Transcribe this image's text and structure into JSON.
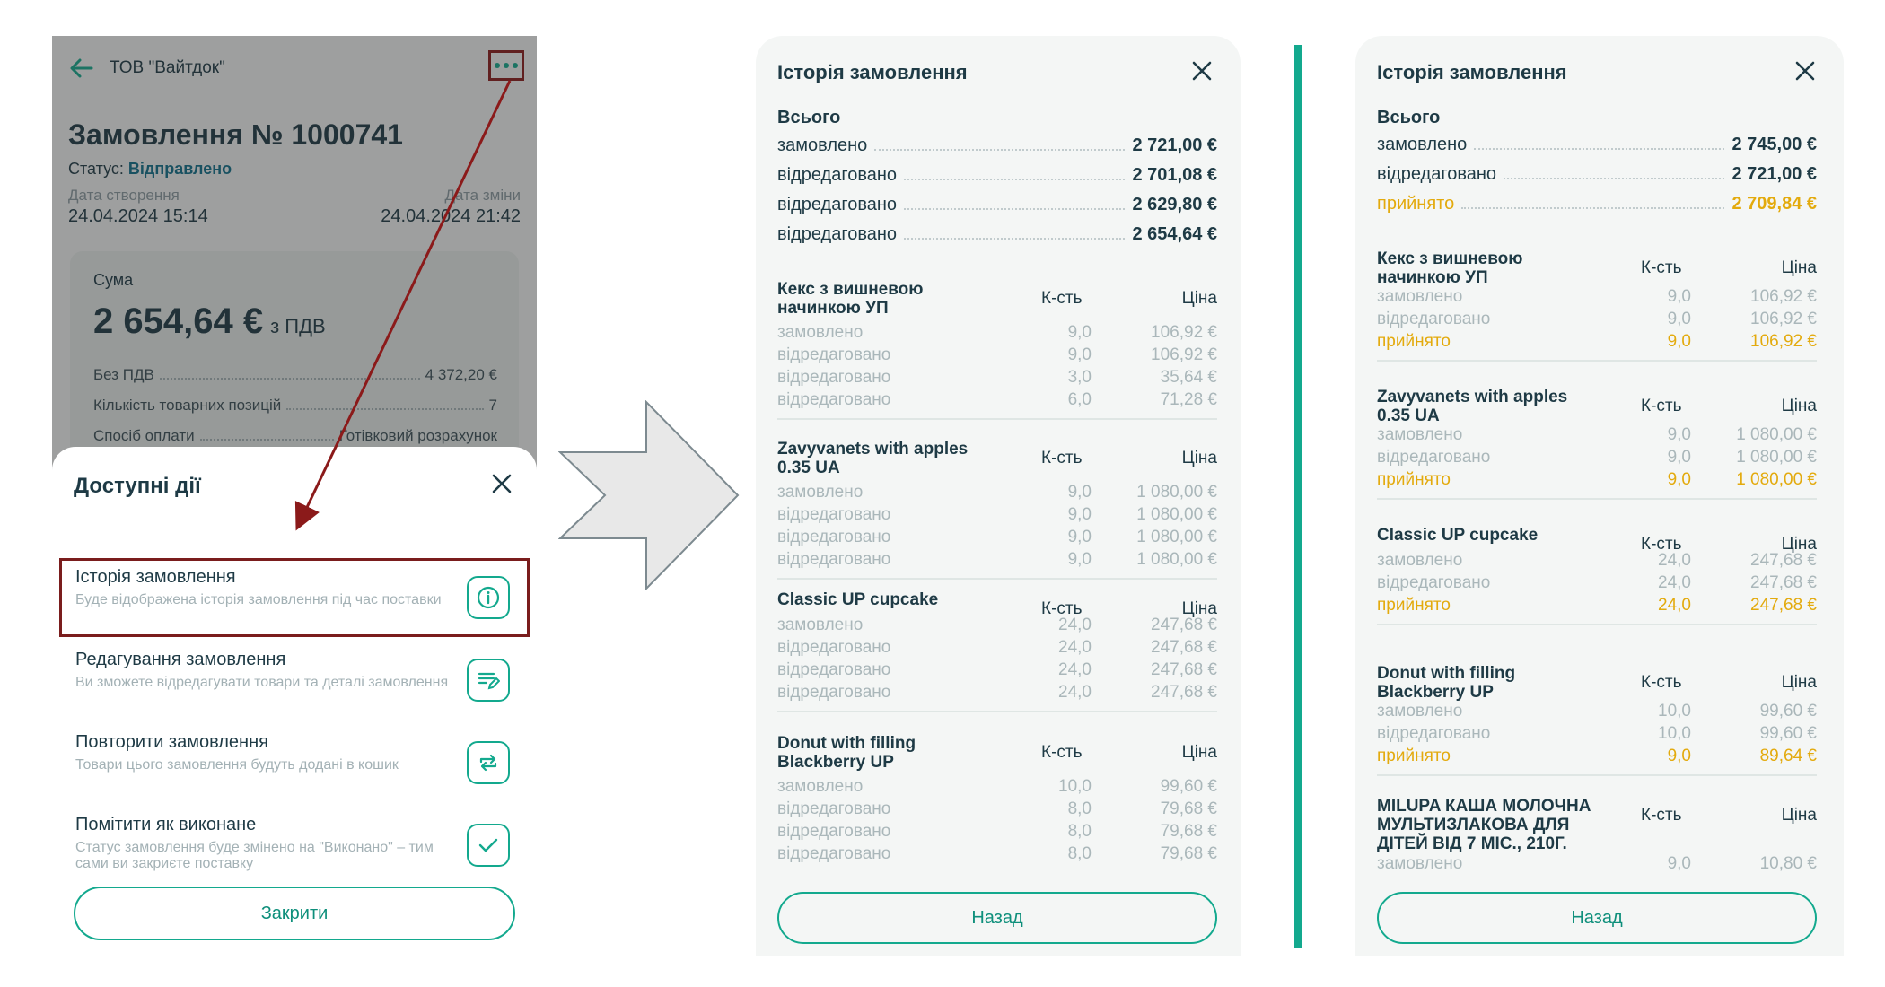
{
  "left": {
    "company": "ТОВ \"Вайтдок\"",
    "order_title": "Замовлення № 1000741",
    "status_label": "Статус:",
    "status_value": "Відправлено",
    "created_label": "Дата створення",
    "created_value": "24.04.2024 15:14",
    "changed_label": "Дата зміни",
    "changed_value": "24.04.2024 21:42",
    "sum_label": "Сума",
    "sum_value": "2 654,64 €",
    "sum_suffix": "з ПДВ",
    "no_vat_label": "Без ПДВ",
    "no_vat_value": "4 372,20 €",
    "positions_label": "Кількість товарних позицій",
    "positions_value": "7",
    "payment_label": "Спосіб оплати",
    "payment_value": "Готівковий розрахунок",
    "sheet_title": "Доступні дії",
    "actions": [
      {
        "title": "Історія замовлення",
        "desc": "Буде відображена історія замовлення під час поставки",
        "icon": "info-icon"
      },
      {
        "title": "Редагування замовлення",
        "desc": "Ви зможете відредагувати товари та деталі замовлення",
        "icon": "edit-list-icon"
      },
      {
        "title": "Повторити замовлення",
        "desc": "Товари цього замовлення будуть додані в кошик",
        "icon": "repeat-icon"
      },
      {
        "title": "Помітити як виконане",
        "desc": "Статус замовлення буде змінено на \"Виконано\" – тим сами ви закриєте поставку",
        "icon": "check-icon"
      }
    ],
    "close_label": "Закрити"
  },
  "mid": {
    "title": "Історія замовлення",
    "total_label": "Всього",
    "totals": [
      {
        "label": "замовлено",
        "value": "2 721,00 €"
      },
      {
        "label": "відредаговано",
        "value": "2 701,08 €"
      },
      {
        "label": "відредаговано",
        "value": "2 629,80 €"
      },
      {
        "label": "відредаговано",
        "value": "2 654,64 €"
      }
    ],
    "qty_header": "К-сть",
    "price_header": "Ціна",
    "items": [
      {
        "name": "Кекс з вишневою начинкою УП",
        "rows": [
          [
            "замовлено",
            "9,0",
            "106,92 €"
          ],
          [
            "відредаговано",
            "9,0",
            "106,92 €"
          ],
          [
            "відредаговано",
            "3,0",
            "35,64 €"
          ],
          [
            "відредаговано",
            "6,0",
            "71,28 €"
          ]
        ]
      },
      {
        "name": "Zavyvanets with apples 0.35 UA",
        "rows": [
          [
            "замовлено",
            "9,0",
            "1 080,00 €"
          ],
          [
            "відредаговано",
            "9,0",
            "1 080,00 €"
          ],
          [
            "відредаговано",
            "9,0",
            "1 080,00 €"
          ],
          [
            "відредаговано",
            "9,0",
            "1 080,00 €"
          ]
        ]
      },
      {
        "name": "Classic UP cupcake",
        "rows": [
          [
            "замовлено",
            "24,0",
            "247,68 €"
          ],
          [
            "відредаговано",
            "24,0",
            "247,68 €"
          ],
          [
            "відредаговано",
            "24,0",
            "247,68 €"
          ],
          [
            "відредаговано",
            "24,0",
            "247,68 €"
          ]
        ]
      },
      {
        "name": "Donut with filling Blackberry UP",
        "rows": [
          [
            "замовлено",
            "10,0",
            "99,60 €"
          ],
          [
            "відредаговано",
            "8,0",
            "79,68 €"
          ],
          [
            "відредаговано",
            "8,0",
            "79,68 €"
          ],
          [
            "відредаговано",
            "8,0",
            "79,68 €"
          ]
        ]
      }
    ],
    "back_label": "Назад"
  },
  "right": {
    "title": "Історія замовлення",
    "total_label": "Всього",
    "totals": [
      {
        "label": "замовлено",
        "value": "2 745,00 €"
      },
      {
        "label": "відредаговано",
        "value": "2 721,00 €"
      },
      {
        "label": "прийнято",
        "value": "2 709,84 €"
      }
    ],
    "qty_header": "К-сть",
    "price_header": "Ціна",
    "items": [
      {
        "name": "Кекс з вишневою начинкою УП",
        "rows": [
          [
            "замовлено",
            "9,0",
            "106,92 €"
          ],
          [
            "відредаговано",
            "9,0",
            "106,92 €"
          ],
          [
            "прийнято",
            "9,0",
            "106,92 €"
          ]
        ]
      },
      {
        "name": "Zavyvanets with apples 0.35 UA",
        "rows": [
          [
            "замовлено",
            "9,0",
            "1 080,00 €"
          ],
          [
            "відредаговано",
            "9,0",
            "1 080,00 €"
          ],
          [
            "прийнято",
            "9,0",
            "1 080,00 €"
          ]
        ]
      },
      {
        "name": "Classic UP cupcake",
        "rows": [
          [
            "замовлено",
            "24,0",
            "247,68 €"
          ],
          [
            "відредаговано",
            "24,0",
            "247,68 €"
          ],
          [
            "прийнято",
            "24,0",
            "247,68 €"
          ]
        ]
      },
      {
        "name": "Donut with filling Blackberry UP",
        "rows": [
          [
            "замовлено",
            "10,0",
            "99,60 €"
          ],
          [
            "відредаговано",
            "10,0",
            "99,60 €"
          ],
          [
            "прийнято",
            "9,0",
            "89,64 €"
          ]
        ]
      },
      {
        "name": "MILUPA КАША МОЛОЧНА МУЛЬТИЗЛАКОВА ДЛЯ ДІТЕЙ ВІД 7 МІС., 210Г.",
        "rows": [
          [
            "замовлено",
            "9,0",
            "10,80 €"
          ]
        ]
      }
    ],
    "back_label": "Назад"
  },
  "colors": {
    "accent": "#13a98e",
    "highlight": "#8b1a1a",
    "accepted": "#e3aa0d"
  }
}
